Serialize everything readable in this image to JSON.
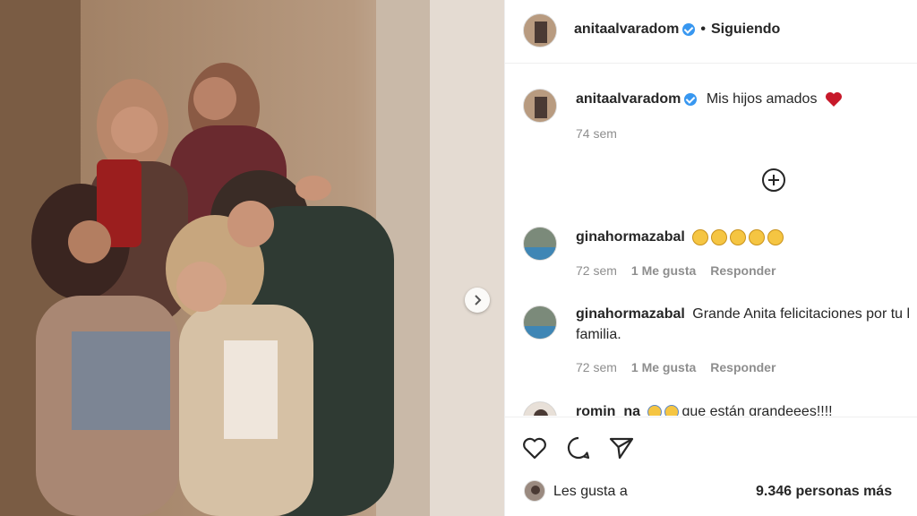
{
  "post": {
    "author": "anitaalvaradom",
    "follow_status": "Siguiendo",
    "separator": "•",
    "caption": "Mis hijos amados",
    "caption_emoji": "red-heart",
    "time": "74 sem"
  },
  "comments": [
    {
      "user": "ginahormazabal",
      "text": "",
      "emoji": "clapping-hands x5",
      "time": "72 sem",
      "likes": "1 Me gusta",
      "reply": "Responder"
    },
    {
      "user": "ginahormazabal",
      "text": "Grande Anita felicitaciones por tu l",
      "text2": "familia.",
      "time": "72 sem",
      "likes": "1 Me gusta",
      "reply": "Responder"
    },
    {
      "user": "romin_na",
      "text": "que están grandeees!!!!",
      "emoji": "screaming-face x2"
    }
  ],
  "likes": {
    "prefix": "Les gusta a",
    "count": "9.346 personas más"
  },
  "colors": {
    "verified": "#3897f0",
    "heart": "#ed4956",
    "muted": "#8e8e8e",
    "text": "#262626"
  }
}
